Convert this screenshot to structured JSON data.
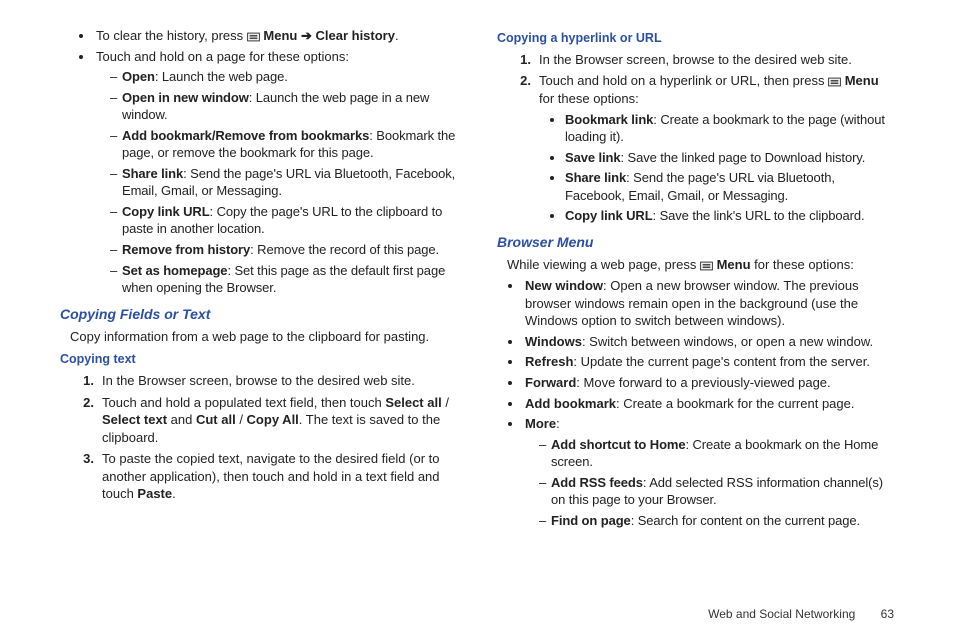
{
  "footer": {
    "section": "Web and Social Networking",
    "page": "63"
  },
  "ui": {
    "menu_word": "Menu",
    "arrow": "➔"
  },
  "left": {
    "clear_hist_pre": "To clear the history, press ",
    "clear_hist_post_label": "Clear history",
    "touch_hold": "Touch and hold on a page for these options:",
    "opts": {
      "open_b": "Open",
      "open_t": ": Launch the web page.",
      "newwin_b": "Open in new window",
      "newwin_t": ": Launch the web page in a new window.",
      "bm_b": "Add bookmark/Remove from bookmarks",
      "bm_t": ": Bookmark the page, or remove the bookmark for this page.",
      "share_b": "Share link",
      "share_t": ": Send the page's URL via Bluetooth, Facebook, Email, Gmail, or Messaging.",
      "copy_b": "Copy link URL",
      "copy_t": ": Copy the page's URL to the clipboard to paste in another location.",
      "rem_b": "Remove from history",
      "rem_t": ": Remove the record of this page.",
      "home_b": "Set as homepage",
      "home_t": ": Set this page as the default first page when opening the Browser."
    },
    "h_copyfields": "Copying Fields or Text",
    "copyfields_intro": "Copy information from a web page to the clipboard for pasting.",
    "h_copytext": "Copying text",
    "ct1": "In the Browser screen, browse to the desired web site.",
    "ct2_a": "Touch and hold a populated text field, then touch ",
    "ct2_selall": "Select all",
    "ct2_sep1": " / ",
    "ct2_seltxt": "Select text",
    "ct2_and": " and ",
    "ct2_cut": "Cut all",
    "ct2_sep2": " / ",
    "ct2_copy": "Copy All",
    "ct2_b": ". The text is saved to the clipboard.",
    "ct3_a": "To paste the copied text, navigate to the desired field (or to another application), then touch and hold in a text field and touch ",
    "ct3_b": "Paste",
    "ct3_c": "."
  },
  "right": {
    "h_copyurl": "Copying a hyperlink or URL",
    "u1": "In the Browser screen, browse to the desired web site.",
    "u2_a": "Touch and hold on a hyperlink or URL, then press ",
    "u2_b": " for these options:",
    "uopts": {
      "bm_b": "Bookmark link",
      "bm_t": ": Create a bookmark to the page (without loading it).",
      "save_b": "Save link",
      "save_t": ": Save the linked page to Download history.",
      "share_b": "Share link",
      "share_t": ": Send the page's URL via Bluetooth, Facebook, Email, Gmail, or Messaging.",
      "copy_b": "Copy link URL",
      "copy_t": ": Save the link's URL to the clipboard."
    },
    "h_browsermenu": "Browser Menu",
    "bm_intro_a": "While viewing a web page, press ",
    "bm_intro_b": " for these options:",
    "bm": {
      "nw_b": "New window",
      "nw_t": ": Open a new browser window. The previous browser windows remain open in the background (use the Windows option to switch between windows).",
      "win_b": "Windows",
      "win_t": ": Switch between windows, or open a new window.",
      "ref_b": "Refresh",
      "ref_t": ": Update the current page's content from the server.",
      "fwd_b": "Forward",
      "fwd_t": ": Move forward to a previously-viewed page.",
      "ab_b": "Add bookmark",
      "ab_t": ": Create a bookmark for the current page.",
      "more_b": "More",
      "more_t": ":",
      "m_sc_b": "Add shortcut to Home",
      "m_sc_t": ": Create a bookmark on the Home screen.",
      "m_rss_b": "Add RSS feeds",
      "m_rss_t": ": Add selected RSS information channel(s) on this page to your Browser.",
      "m_find_b": "Find on page",
      "m_find_t": ": Search for content on the current page."
    }
  }
}
